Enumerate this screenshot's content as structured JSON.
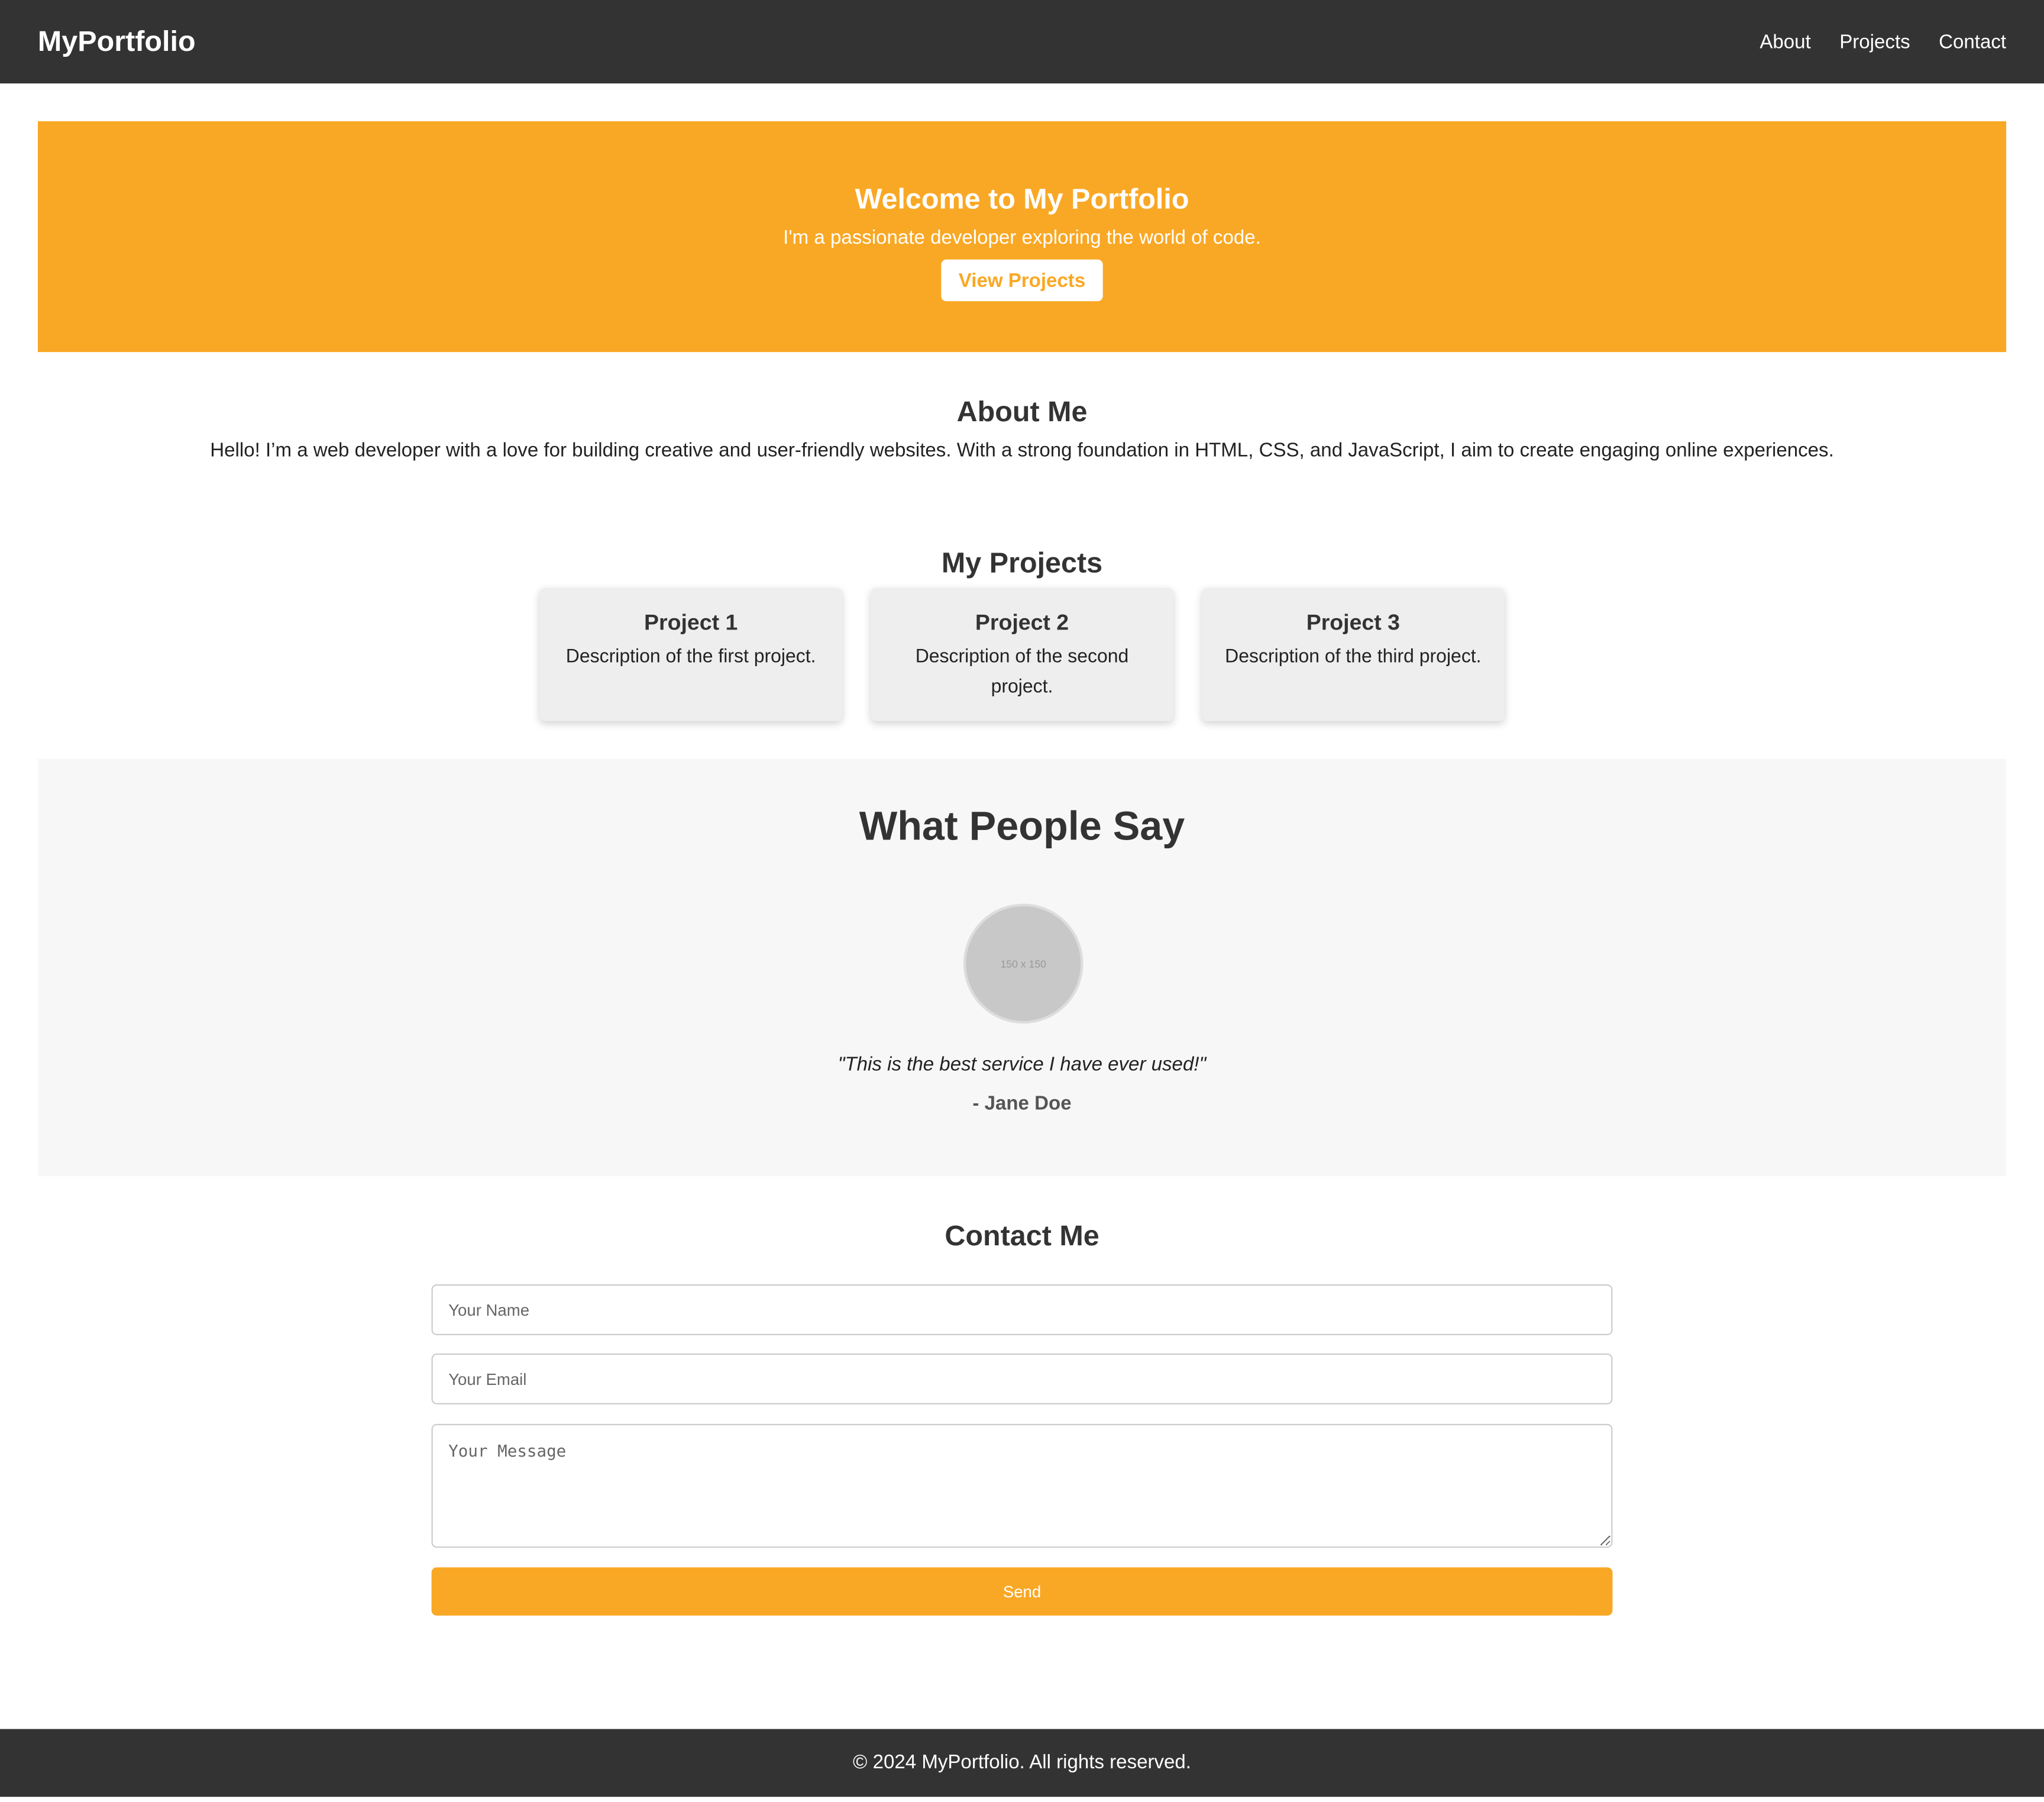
{
  "colors": {
    "accent": "#f9a825",
    "dark": "#333333",
    "card_bg": "#eeeeee",
    "testimonial_bg": "#f7f7f7"
  },
  "header": {
    "brand": "MyPortfolio",
    "nav": [
      "About",
      "Projects",
      "Contact"
    ]
  },
  "hero": {
    "title": "Welcome to My Portfolio",
    "subtitle": "I'm a passionate developer exploring the world of code.",
    "button": "View Projects"
  },
  "about": {
    "title": "About Me",
    "text": "Hello! I’m a web developer with a love for building creative and user-friendly websites. With a strong foundation in HTML, CSS, and JavaScript, I aim to create engaging online experiences."
  },
  "projects": {
    "title": "My Projects",
    "items": [
      {
        "title": "Project 1",
        "description": "Description of the first project."
      },
      {
        "title": "Project 2",
        "description": "Description of the second project."
      },
      {
        "title": "Project 3",
        "description": "Description of the third project."
      }
    ]
  },
  "testimonials": {
    "title": "What People Say",
    "avatar_placeholder": "150 x 150",
    "quote": "\"This is the best service I have ever used!\"",
    "author": "- Jane Doe"
  },
  "contact": {
    "title": "Contact Me",
    "name_placeholder": "Your Name",
    "email_placeholder": "Your Email",
    "message_placeholder": "Your Message",
    "send_label": "Send"
  },
  "footer": {
    "text": "© 2024 MyPortfolio. All rights reserved."
  }
}
